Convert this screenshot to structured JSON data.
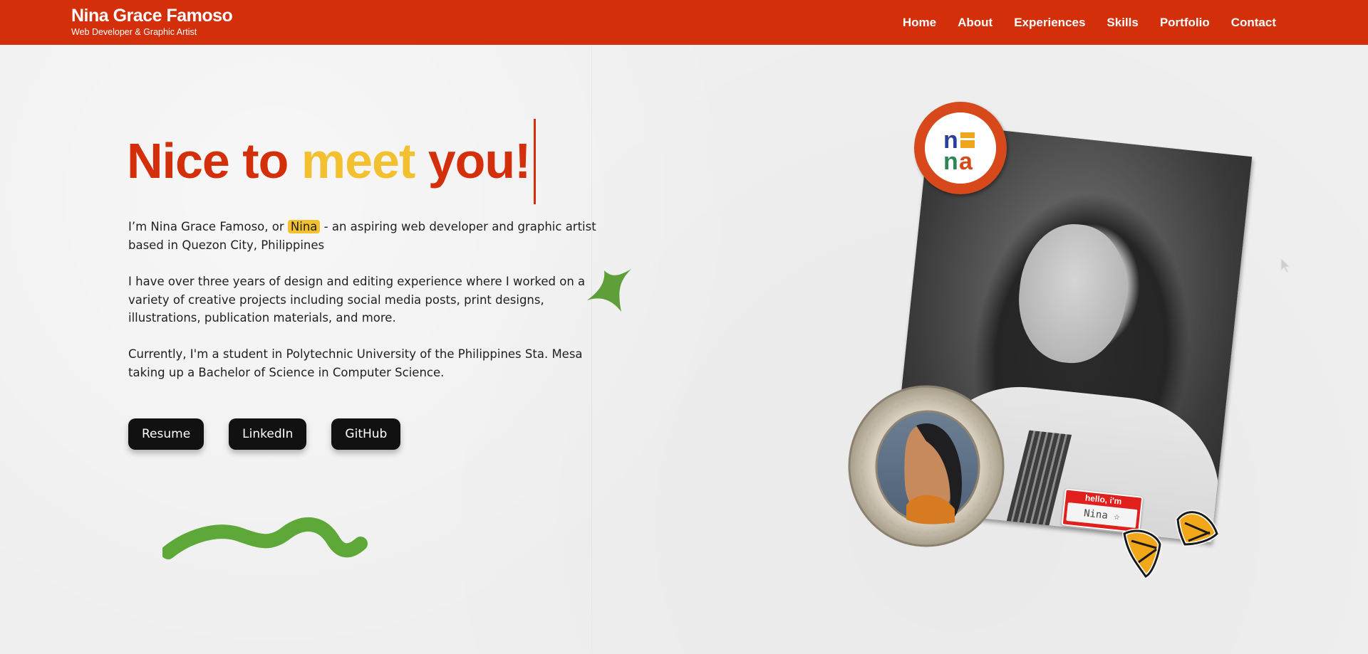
{
  "header": {
    "name": "Nina Grace Famoso",
    "tagline": "Web Developer & Graphic Artist",
    "nav": [
      "Home",
      "About",
      "Experiences",
      "Skills",
      "Portfolio",
      "Contact"
    ]
  },
  "hero": {
    "title_words": [
      "Nice to",
      "meet",
      "you!"
    ],
    "intro_before": "I’m Nina Grace Famoso, or",
    "nickname": "Nina",
    "intro_after": "- an aspiring web developer and graphic artist based in Quezon City, Philippines",
    "para2": "I have over three years of design and editing experience where I worked on a variety of creative projects including social media posts, print designs, illustrations, publication materials, and more.",
    "para3": "Currently, I'm a student in Polytechnic University of the Philippines Sta. Mesa taking up a Bachelor of Science in Computer Science.",
    "buttons": [
      "Resume",
      "LinkedIn",
      "GitHub"
    ]
  },
  "collage": {
    "sticker_top": "hello, i'm",
    "sticker_name": "Nina ☆",
    "logo_lines": [
      "ni",
      "na"
    ]
  },
  "colors": {
    "brand_red": "#d32f0b",
    "accent_yellow": "#f3c12f",
    "accent_green": "#5e9f3a",
    "button_black": "#111111"
  },
  "icons": [
    "sparkle-star-icon",
    "squiggle-decoration",
    "butterfly-sticker-icon",
    "cursor-icon"
  ]
}
